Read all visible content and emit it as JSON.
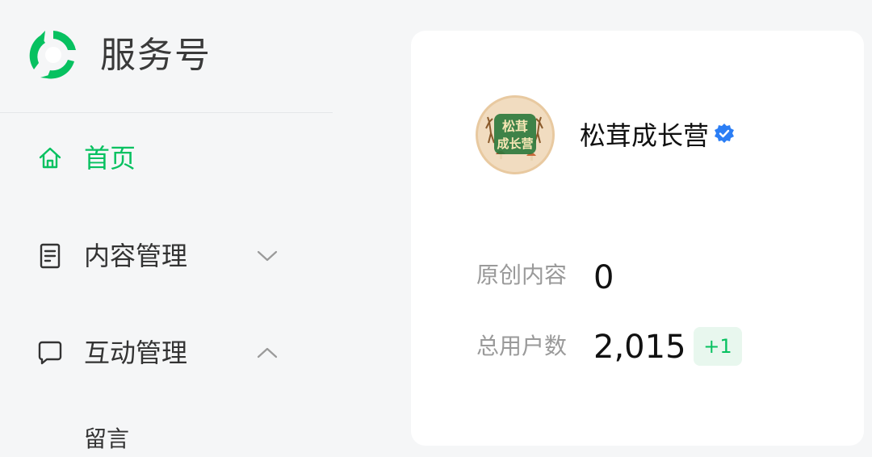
{
  "brand": {
    "title": "服务号",
    "logo_icon": "wechat-service-logo",
    "accent": "#07c160"
  },
  "nav": {
    "items": [
      {
        "label": "首页",
        "icon": "home-icon",
        "active": true
      },
      {
        "label": "内容管理",
        "icon": "document-icon",
        "chevron": "chevron-down-icon"
      },
      {
        "label": "互动管理",
        "icon": "comment-icon",
        "chevron": "chevron-up-icon"
      }
    ],
    "sub_items": [
      {
        "label": "留言"
      }
    ]
  },
  "account": {
    "name": "松茸成长营",
    "avatar_text": [
      "松茸",
      "成长营"
    ],
    "verified": true,
    "verified_color": "#2b7ef5"
  },
  "stats": [
    {
      "label": "原创内容",
      "value": "0"
    },
    {
      "label": "总用户数",
      "value": "2,015",
      "delta": "+1"
    }
  ]
}
